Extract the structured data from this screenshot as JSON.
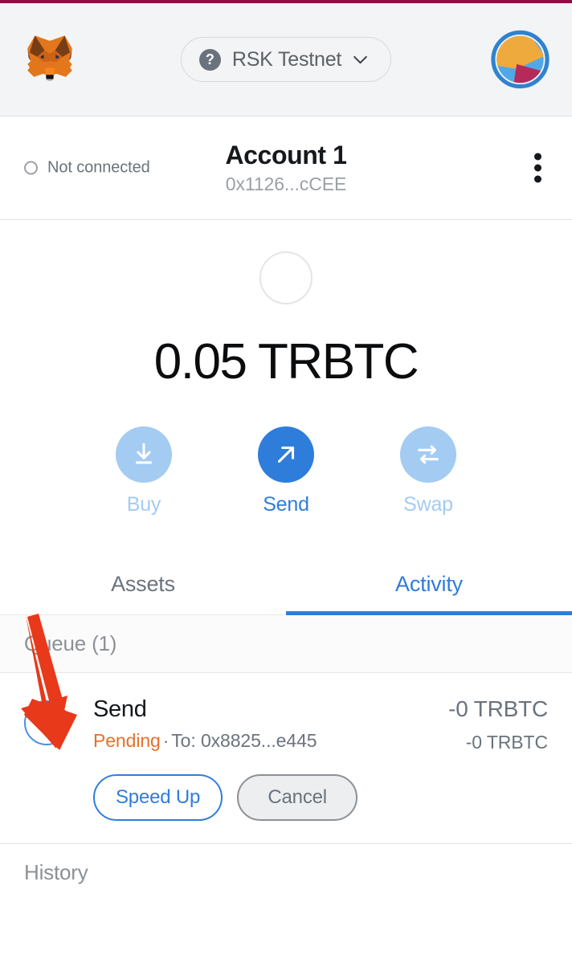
{
  "header": {
    "logo_icon": "metamask-fox-logo",
    "network": {
      "icon": "question-mark-icon",
      "name": "RSK Testnet",
      "chevron_icon": "chevron-down-icon"
    },
    "avatar_icon": "account-jazzicon-avatar"
  },
  "account": {
    "connection_status": "Not connected",
    "connection_icon": "empty-circle-icon",
    "name": "Account 1",
    "address": "0x1126...cCEE",
    "menu_icon": "kebab-menu-icon"
  },
  "balance": {
    "token_icon": "token-placeholder-circle",
    "amount": "0.05 TRBTC"
  },
  "actions": [
    {
      "label": "Buy",
      "icon": "download-arrow-icon",
      "enabled": false
    },
    {
      "label": "Send",
      "icon": "diagonal-arrow-icon",
      "enabled": true
    },
    {
      "label": "Swap",
      "icon": "swap-arrows-icon",
      "enabled": false
    }
  ],
  "tabs": [
    {
      "label": "Assets",
      "active": false
    },
    {
      "label": "Activity",
      "active": true
    }
  ],
  "queue": {
    "title": "Queue (1)",
    "transactions": [
      {
        "icon": "send-arrow-circle-icon",
        "title": "Send",
        "status": "Pending",
        "separator": "·",
        "recipient": "To: 0x8825...e445",
        "amount_primary": "-0 TRBTC",
        "amount_secondary": "-0 TRBTC",
        "speed_up_label": "Speed Up",
        "cancel_label": "Cancel"
      }
    ]
  },
  "history": {
    "title": "History"
  },
  "annotation": {
    "arrow_icon": "red-pointer-arrow",
    "color": "#e8391a"
  },
  "colors": {
    "accent": "#2f7ddb",
    "accent_muted": "#a4cbf2",
    "pending": "#e8702a",
    "text_primary": "#15181c",
    "text_muted": "#6a737d",
    "header_bg": "#f2f4f6",
    "top_strip": "#8b1045"
  }
}
